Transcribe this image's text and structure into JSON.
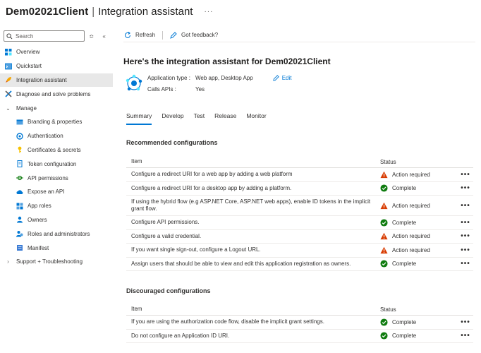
{
  "title": {
    "app": "Dem02021Client",
    "separator": "|",
    "page": "Integration assistant",
    "more": "···"
  },
  "sidebar": {
    "search_placeholder": "Search",
    "items": [
      {
        "label": "Overview",
        "icon": "overview-icon"
      },
      {
        "label": "Quickstart",
        "icon": "quickstart-icon"
      },
      {
        "label": "Integration assistant",
        "icon": "rocket-icon",
        "active": true
      },
      {
        "label": "Diagnose and solve problems",
        "icon": "wrench-icon"
      },
      {
        "label": "Manage",
        "icon": "chevron-down-icon"
      },
      {
        "label": "Branding & properties",
        "icon": "branding-icon"
      },
      {
        "label": "Authentication",
        "icon": "authentication-icon"
      },
      {
        "label": "Certificates & secrets",
        "icon": "key-icon"
      },
      {
        "label": "Token configuration",
        "icon": "token-icon"
      },
      {
        "label": "API permissions",
        "icon": "api-permissions-icon"
      },
      {
        "label": "Expose an API",
        "icon": "cloud-icon"
      },
      {
        "label": "App roles",
        "icon": "app-roles-icon"
      },
      {
        "label": "Owners",
        "icon": "owners-icon"
      },
      {
        "label": "Roles and administrators",
        "icon": "roles-icon"
      },
      {
        "label": "Manifest",
        "icon": "manifest-icon"
      },
      {
        "label": "Support + Troubleshooting",
        "icon": "chevron-right-icon"
      }
    ]
  },
  "toolbar": {
    "refresh_label": "Refresh",
    "feedback_label": "Got feedback?"
  },
  "main": {
    "heading": "Here's the integration assistant for Dem02021Client",
    "app_type_label": "Application type :",
    "app_type_value": "Web app, Desktop App",
    "edit_label": "Edit",
    "calls_apis_label": "Calls APIs :",
    "calls_apis_value": "Yes",
    "tabs": [
      "Summary",
      "Develop",
      "Test",
      "Release",
      "Monitor"
    ]
  },
  "recommended": {
    "title": "Recommended configurations",
    "col_item": "Item",
    "col_status": "Status",
    "rows": [
      {
        "item": "Configure a redirect URI for a web app by adding a web platform",
        "status": "Action required",
        "kind": "warning"
      },
      {
        "item": "Configure a redirect URI for a desktop app by adding a platform.",
        "status": "Complete",
        "kind": "complete"
      },
      {
        "item": "If using the hybrid flow (e.g ASP.NET Core, ASP.NET web apps), enable ID tokens in the implicit grant flow.",
        "status": "Action required",
        "kind": "warning"
      },
      {
        "item": "Configure API permissions.",
        "status": "Complete",
        "kind": "complete"
      },
      {
        "item": "Configure a valid credential.",
        "status": "Action required",
        "kind": "warning"
      },
      {
        "item": "If you want single sign-out, configure a Logout URL.",
        "status": "Action required",
        "kind": "warning"
      },
      {
        "item": "Assign users that should be able to view and edit this application registration as owners.",
        "status": "Complete",
        "kind": "complete"
      }
    ]
  },
  "discouraged": {
    "title": "Discouraged configurations",
    "col_item": "Item",
    "col_status": "Status",
    "rows": [
      {
        "item": "If you are using the authorization code flow, disable the implicit grant settings.",
        "status": "Complete",
        "kind": "complete"
      },
      {
        "item": "Do not configure an Application ID URI.",
        "status": "Complete",
        "kind": "complete"
      }
    ]
  },
  "more_glyph": "•••",
  "colors": {
    "accent": "#0078d4",
    "warning": "#d83b01",
    "complete": "#107c10",
    "active_bg": "#e8e8e8"
  }
}
